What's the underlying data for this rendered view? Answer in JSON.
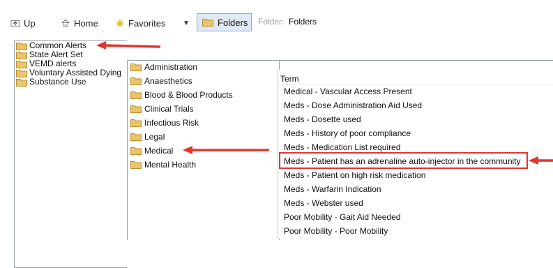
{
  "toolbar": {
    "up_label": "Up",
    "home_label": "Home",
    "favorites_label": "Favorites",
    "dropdown_glyph": "▼",
    "folders_label": "Folders",
    "folder_caption": "Folder:",
    "folder_value": "Folders"
  },
  "tree": {
    "items": [
      {
        "label": "Common Alerts"
      },
      {
        "label": "State Alert Set"
      },
      {
        "label": "VEMD alerts"
      },
      {
        "label": "Voluntary Assisted Dying"
      },
      {
        "label": "Substance Use"
      }
    ]
  },
  "categories": {
    "items": [
      {
        "label": "Administration"
      },
      {
        "label": "Anaesthetics"
      },
      {
        "label": "Blood & Blood Products"
      },
      {
        "label": "Clinical Trials"
      },
      {
        "label": "Infectious Risk"
      },
      {
        "label": "Legal"
      },
      {
        "label": "Medical"
      },
      {
        "label": "Mental Health"
      }
    ]
  },
  "terms": {
    "header": "Term",
    "items": [
      {
        "label": "Medical - Vascular Access Present"
      },
      {
        "label": "Meds - Dose Administration Aid Used"
      },
      {
        "label": "Meds - Dosette used"
      },
      {
        "label": "Meds - History of poor compliance"
      },
      {
        "label": "Meds - Medication List required"
      },
      {
        "label": "Meds - Patient has an adrenaline auto-injector in the community"
      },
      {
        "label": "Meds - Patient on high risk medication"
      },
      {
        "label": "Meds - Warfarin Indication"
      },
      {
        "label": "Meds - Webster used"
      },
      {
        "label": "Poor Mobility - Gait Aid Needed"
      },
      {
        "label": "Poor Mobility - Poor Mobility"
      }
    ]
  },
  "colors": {
    "annotation": "#e3342f",
    "folder": "#e8c56a",
    "selection_border": "#8aa9cf",
    "selection_fill": "#dfe9f6"
  }
}
